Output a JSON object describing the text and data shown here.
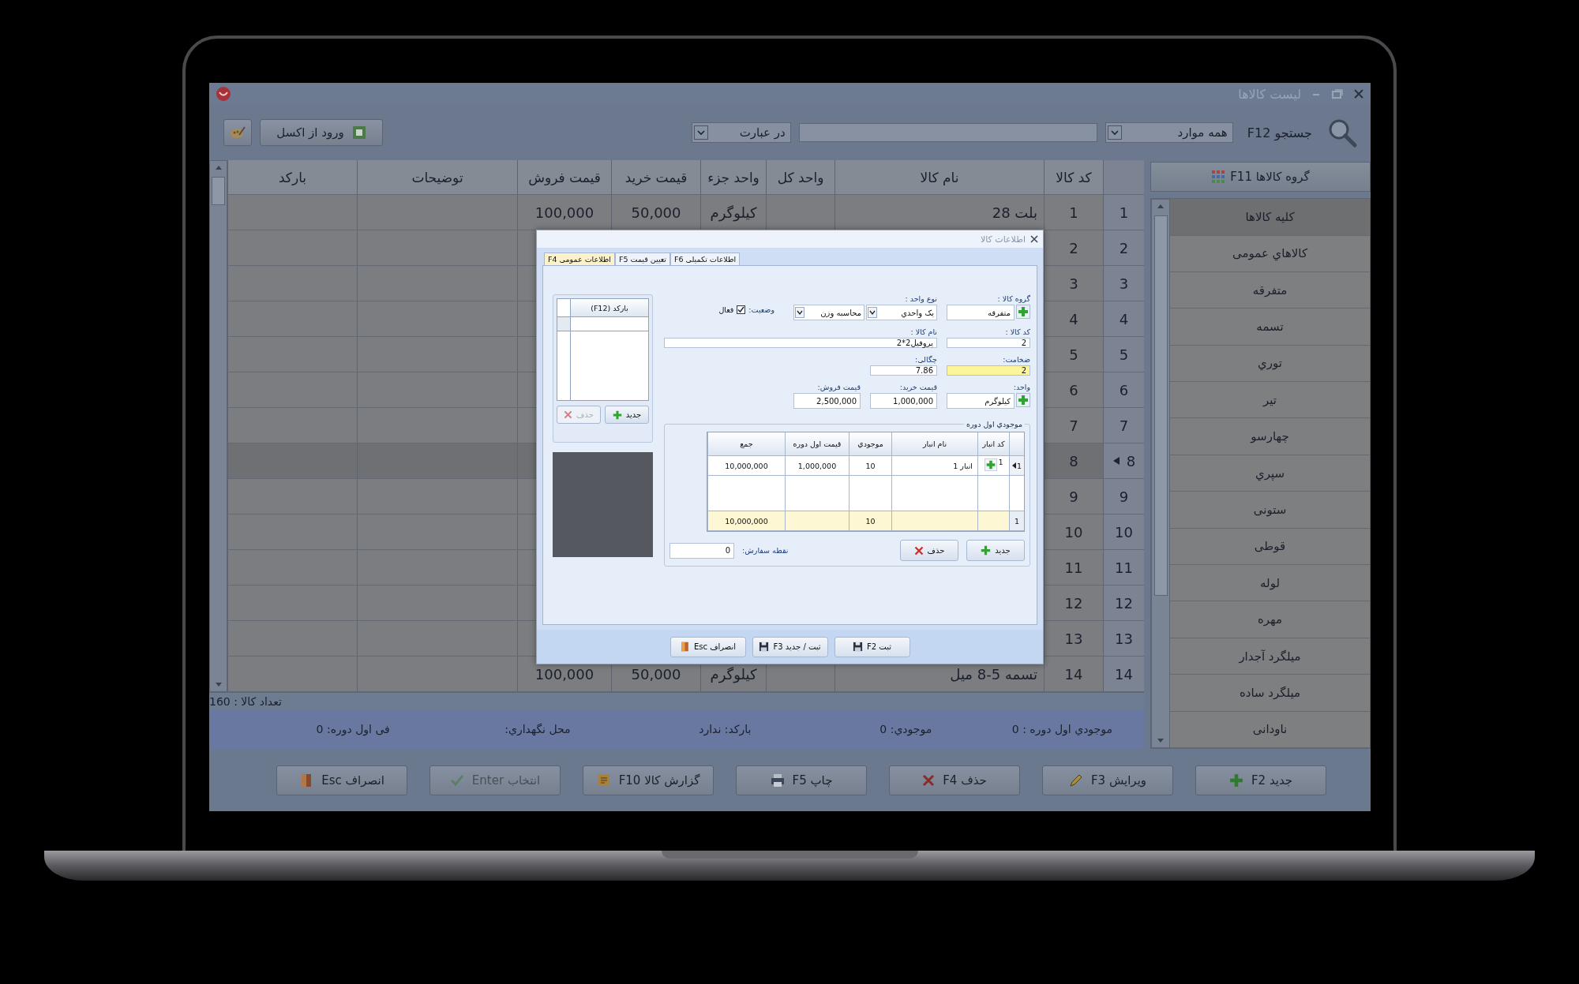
{
  "window": {
    "title": "لیست کالاها"
  },
  "toolbar": {
    "import_button": "ورود از اکسل",
    "match": "در عبارت",
    "scope": "همه موارد",
    "search_label": "جستجو F12"
  },
  "table": {
    "columns": [
      "کد کالا",
      "نام کالا",
      "واحد کل",
      "واحد جزء",
      "قیمت خرید",
      "قیمت فروش",
      "توضیحات",
      "بارکد"
    ],
    "rows": [
      {
        "number": "1",
        "code": "1",
        "name": "بلت 28",
        "sub_unit": "کیلوگرم",
        "buy_price": "50,000",
        "sell_price": "100,000",
        "selected": false
      },
      {
        "number": "2",
        "code": "2",
        "selected": false
      },
      {
        "number": "3",
        "code": "3",
        "selected": false
      },
      {
        "number": "4",
        "code": "4",
        "selected": false
      },
      {
        "number": "5",
        "code": "5",
        "selected": false
      },
      {
        "number": "6",
        "code": "6",
        "selected": false
      },
      {
        "number": "7",
        "code": "7",
        "selected": false
      },
      {
        "number": "8",
        "code": "8",
        "selected": true
      },
      {
        "number": "9",
        "code": "9",
        "selected": false
      },
      {
        "number": "10",
        "code": "10",
        "selected": false
      },
      {
        "number": "11",
        "code": "11",
        "selected": false
      },
      {
        "number": "12",
        "code": "12",
        "selected": false
      },
      {
        "number": "13",
        "code": "13",
        "selected": false
      },
      {
        "number": "14",
        "code": "14",
        "name": "تسمه 5-8 میل",
        "sub_unit": "کیلوگرم",
        "buy_price": "50,000",
        "sell_price": "100,000",
        "selected": false
      }
    ],
    "count": "تعداد کالا : 160"
  },
  "details": [
    "موجودي اول دوره : 0",
    "موجودي: 0",
    "بارکد: ندارد",
    "محل نگهداري:",
    "فی اول دوره: 0"
  ],
  "groups": {
    "title": "گروه کالاها F11",
    "items": [
      {
        "label": "کلیه کالاها",
        "selected": true
      },
      {
        "label": "کالاهاي عمومی",
        "selected": false
      },
      {
        "label": "متفرقه",
        "selected": false
      },
      {
        "label": "تسمه",
        "selected": false
      },
      {
        "label": "توري",
        "selected": false
      },
      {
        "label": "تیر",
        "selected": false
      },
      {
        "label": "چهارسو",
        "selected": false
      },
      {
        "label": "سپري",
        "selected": false
      },
      {
        "label": "ستونی",
        "selected": false
      },
      {
        "label": "قوطی",
        "selected": false
      },
      {
        "label": "لوله",
        "selected": false
      },
      {
        "label": "مهره",
        "selected": false
      },
      {
        "label": "میلگرد آجدار",
        "selected": false
      },
      {
        "label": "میلگرد ساده",
        "selected": false
      },
      {
        "label": "ناودانی",
        "selected": false
      }
    ]
  },
  "actions": [
    {
      "label": "جدید F2",
      "disabled": false
    },
    {
      "label": "ویرایش F3",
      "disabled": false
    },
    {
      "label": "حذف F4",
      "disabled": false
    },
    {
      "label": "چاپ F5",
      "disabled": false
    },
    {
      "label": "گزارش کالا F10",
      "disabled": false
    },
    {
      "label": "انتخاب Enter",
      "disabled": true
    },
    {
      "label": "انصراف Esc",
      "disabled": false
    }
  ],
  "dialog": {
    "title": "اطلاعات کالا",
    "tabs": [
      {
        "label": "اطلاعات تکمیلی F6",
        "selected": false
      },
      {
        "label": "تعیین قیمت F5",
        "selected": false
      },
      {
        "label": "اطلاعات عمومی F4",
        "selected": true
      }
    ],
    "form": {
      "group": {
        "label": "گروه کالا :",
        "value": "متفرقه"
      },
      "unit_type": {
        "label": "نوع واحد :",
        "value": "یک واحدي",
        "calc": "محاسبه وزن"
      },
      "status": {
        "label": "وضعیت:",
        "option": "فعال",
        "checked": true
      },
      "code": {
        "label": "کد کالا :",
        "value": "2"
      },
      "name": {
        "label": "نام کالا :",
        "value": "پروفیل2*2"
      },
      "thickness": {
        "label": "ضخامت:",
        "value": "2",
        "focused": true
      },
      "density": {
        "label": "چگالی:",
        "value": "7.86"
      },
      "unit": {
        "label": "واحد:",
        "value": "کیلوگرم"
      },
      "buy_price": {
        "label": "قیمت خرید:",
        "value": "1,000,000"
      },
      "sell_price": {
        "label": "قیمت فروش:",
        "value": "2,500,000"
      }
    },
    "barcodes": {
      "column": "(F12) بارکد",
      "buttons": [
        {
          "label": "جدید",
          "disabled": false
        },
        {
          "label": "حذف",
          "disabled": true
        }
      ]
    },
    "stock": {
      "title": "موجودي اول دوره",
      "columns": [
        "کد انبار",
        "نام انبار",
        "موجودي",
        "قیمت اول دوره",
        "جمع"
      ],
      "rows": [
        {
          "marker": "1",
          "code": "1",
          "warehouse": "انبار 1",
          "quantity": "10",
          "price": "1,000,000",
          "total": "10,000,000",
          "selected": true
        }
      ],
      "footer": {
        "marker": "1",
        "quantity": "10",
        "total": "10,000,000"
      },
      "buttons": [
        "جدید",
        "حذف"
      ],
      "reorder": {
        "label": "نقطه سفارش:",
        "value": "0"
      }
    },
    "footer_buttons": [
      "ثبت F2",
      "ثبت / جدید F3",
      "انصراف Esc"
    ]
  }
}
